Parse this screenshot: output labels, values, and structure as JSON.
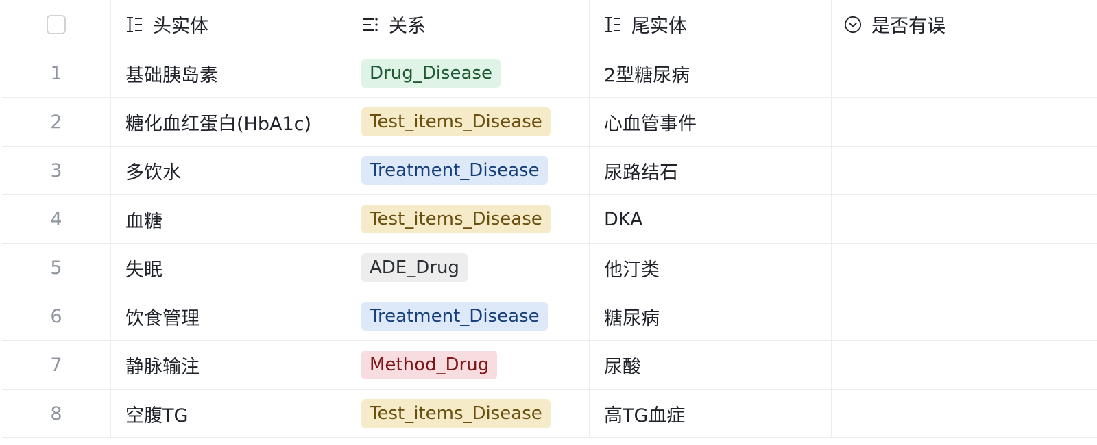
{
  "header": {
    "col_head": "头实体",
    "col_relation": "关系",
    "col_tail": "尾实体",
    "col_error": "是否有误",
    "icons": [
      "text-field-icon",
      "multi-select-icon",
      "text-field-icon",
      "single-select-icon"
    ]
  },
  "tag_colors": {
    "Drug_Disease": {
      "bg": "#dff3e7",
      "fg": "#1c5a32"
    },
    "Test_items_Disease": {
      "bg": "#f6ebc8",
      "fg": "#6a4f0e"
    },
    "Treatment_Disease": {
      "bg": "#dde9f8",
      "fg": "#173f7a"
    },
    "ADE_Drug": {
      "bg": "#ededed",
      "fg": "#2b2f36"
    },
    "Method_Drug": {
      "bg": "#f8dde0",
      "fg": "#7d1619"
    }
  },
  "rows": [
    {
      "num": "1",
      "head": "基础胰岛素",
      "relation": "Drug_Disease",
      "tail": "2型糖尿病",
      "error": ""
    },
    {
      "num": "2",
      "head": "糖化血红蛋白(HbA1c)",
      "relation": "Test_items_Disease",
      "tail": "心血管事件",
      "error": ""
    },
    {
      "num": "3",
      "head": "多饮水",
      "relation": "Treatment_Disease",
      "tail": "尿路结石",
      "error": ""
    },
    {
      "num": "4",
      "head": "血糖",
      "relation": "Test_items_Disease",
      "tail": "DKA",
      "error": ""
    },
    {
      "num": "5",
      "head": "失眠",
      "relation": "ADE_Drug",
      "tail": "他汀类",
      "error": ""
    },
    {
      "num": "6",
      "head": "饮食管理",
      "relation": "Treatment_Disease",
      "tail": "糖尿病",
      "error": ""
    },
    {
      "num": "7",
      "head": "静脉输注",
      "relation": "Method_Drug",
      "tail": "尿酸",
      "error": ""
    },
    {
      "num": "8",
      "head": "空腹TG",
      "relation": "Test_items_Disease",
      "tail": "高TG血症",
      "error": ""
    }
  ]
}
